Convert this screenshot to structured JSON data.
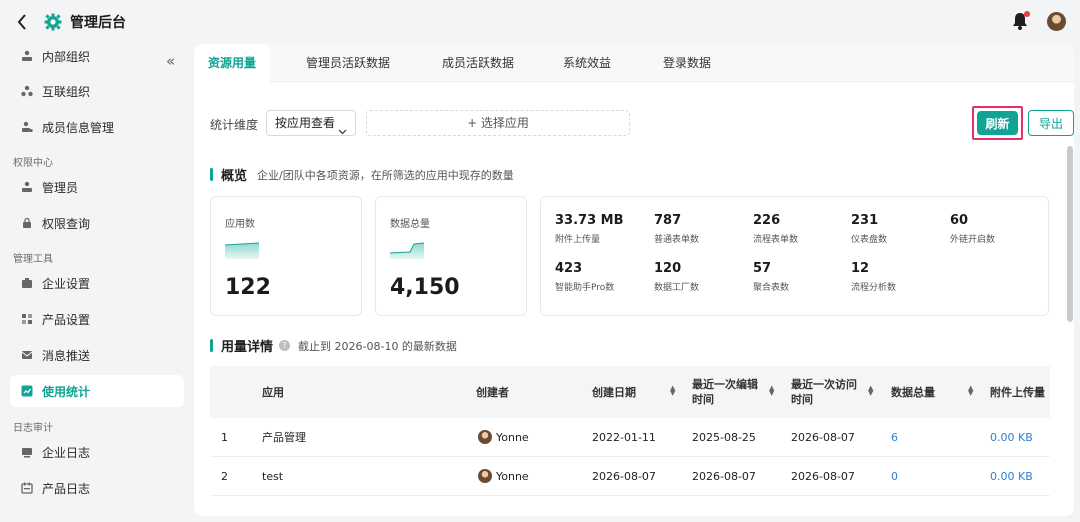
{
  "app": {
    "title": "管理后台"
  },
  "sidebar": {
    "items": [
      {
        "label": "内部组织",
        "icon": "org-icon"
      },
      {
        "label": "互联组织",
        "icon": "network-icon"
      },
      {
        "label": "成员信息管理",
        "icon": "member-icon"
      },
      {
        "label": "管理员",
        "icon": "admin-icon"
      },
      {
        "label": "权限查询",
        "icon": "lock-icon"
      },
      {
        "label": "企业设置",
        "icon": "company-icon"
      },
      {
        "label": "产品设置",
        "icon": "grid-icon"
      },
      {
        "label": "消息推送",
        "icon": "mail-icon"
      },
      {
        "label": "使用统计",
        "icon": "chart-icon",
        "active": true
      },
      {
        "label": "企业日志",
        "icon": "log-icon"
      },
      {
        "label": "产品日志",
        "icon": "calendar-icon"
      }
    ],
    "groups": [
      "权限中心",
      "管理工具",
      "日志审计"
    ]
  },
  "tabs": [
    "资源用量",
    "管理员活跃数据",
    "成员活跃数据",
    "系统效益",
    "登录数据"
  ],
  "filter": {
    "label": "统计维度",
    "select_value": "按应用查看",
    "picker": "+ 选择应用",
    "refresh": "刷新",
    "export": "导出"
  },
  "overview": {
    "title": "概览",
    "desc": "企业/团队中各项资源，在所筛选的应用中现存的数量",
    "cards": [
      {
        "label": "应用数",
        "value": "122"
      },
      {
        "label": "数据总量",
        "value": "4,150"
      }
    ],
    "stats": [
      {
        "value": "33.73 MB",
        "label": "附件上传量"
      },
      {
        "value": "787",
        "label": "普通表单数"
      },
      {
        "value": "226",
        "label": "流程表单数"
      },
      {
        "value": "231",
        "label": "仪表盘数"
      },
      {
        "value": "60",
        "label": "外链开启数"
      },
      {
        "value": "423",
        "label": "智能助手Pro数"
      },
      {
        "value": "120",
        "label": "数据工厂数"
      },
      {
        "value": "57",
        "label": "聚合表数"
      },
      {
        "value": "12",
        "label": "流程分析数"
      }
    ]
  },
  "usage": {
    "title": "用量详情",
    "desc": "截止到 2026-08-10 的最新数据"
  },
  "table": {
    "headers": [
      "应用",
      "创建者",
      "创建日期",
      "最近一次编辑时间",
      "最近一次访问时间",
      "数据总量",
      "附件上传量"
    ],
    "rows": [
      {
        "idx": "1",
        "app": "产品管理",
        "creator": "Yonne",
        "created": "2022-01-11",
        "edited": "2025-08-25",
        "visited": "2026-08-07",
        "total": "6",
        "attach": "0.00 KB"
      },
      {
        "idx": "2",
        "app": "test",
        "creator": "Yonne",
        "created": "2026-08-07",
        "edited": "2026-08-07",
        "visited": "2026-08-07",
        "total": "0",
        "attach": "0.00 KB"
      }
    ]
  },
  "colors": {
    "accent": "#11a394",
    "highlight": "#e0316e",
    "link": "#2f7fd6"
  }
}
